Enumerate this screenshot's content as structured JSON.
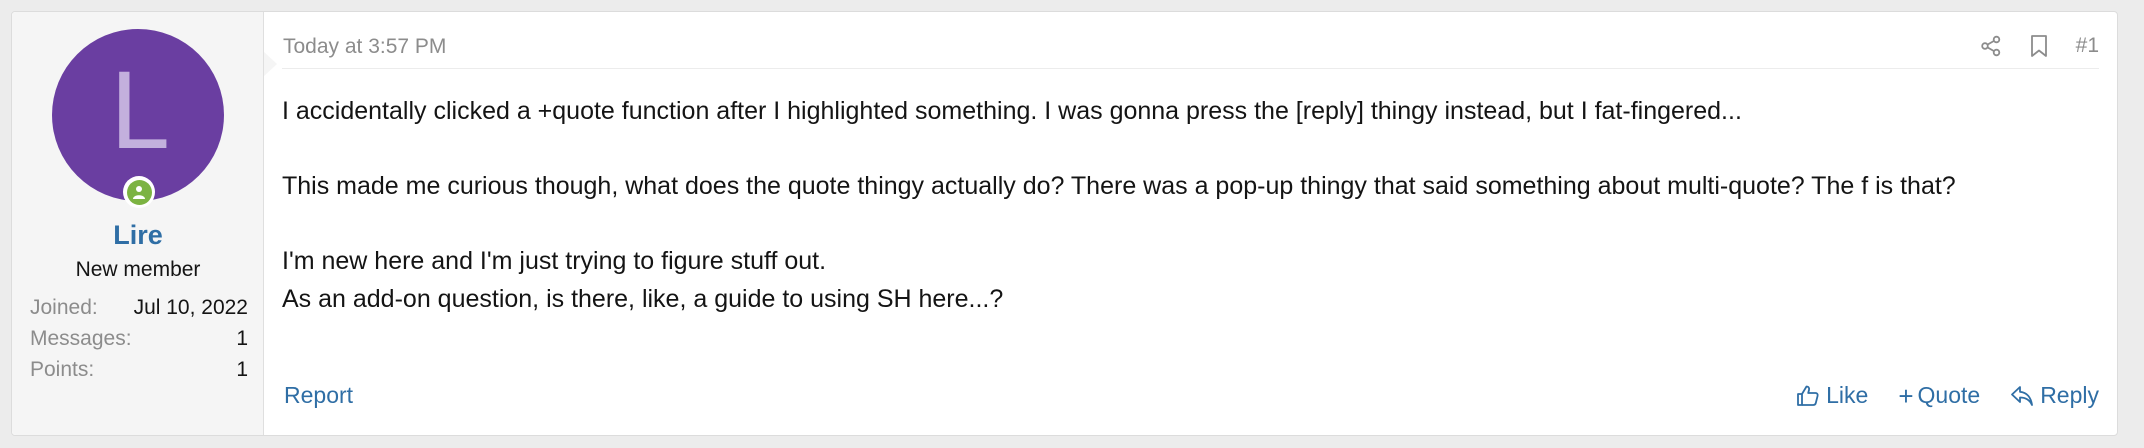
{
  "user": {
    "avatar_letter": "L",
    "name": "Lire",
    "title": "New member",
    "online": true,
    "stats": [
      {
        "label": "Joined:",
        "value": "Jul 10, 2022"
      },
      {
        "label": "Messages:",
        "value": "1"
      },
      {
        "label": "Points:",
        "value": "1"
      }
    ]
  },
  "post": {
    "timestamp": "Today at 3:57 PM",
    "number": "#1",
    "header_icons": [
      "share-icon",
      "bookmark-icon"
    ],
    "paragraphs": [
      "I accidentally clicked a +quote function after I highlighted something. I was gonna press the [reply] thingy instead, but I fat-fingered...",
      "This made me curious though, what does the quote thingy actually do? There was a pop-up thingy that said something about multi-quote? The f is that?",
      "I'm new here and I'm just trying to figure stuff out.",
      "As an add-on question, is there, like, a guide to using SH here...?"
    ],
    "report_label": "Report",
    "actions": {
      "like": "Like",
      "quote_prefix": "+",
      "quote": "Quote",
      "reply": "Reply"
    }
  },
  "colors": {
    "avatar_bg": "#6a3ea1",
    "link": "#2f6ea5",
    "online": "#7cb342"
  }
}
